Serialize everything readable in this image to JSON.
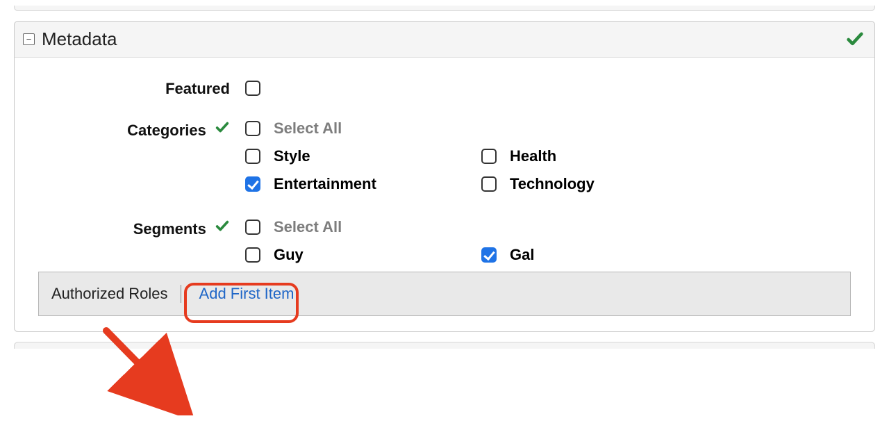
{
  "panel": {
    "title": "Metadata",
    "collapse_glyph": "−"
  },
  "featured": {
    "label": "Featured",
    "checked": false
  },
  "categories": {
    "label": "Categories",
    "section_valid": true,
    "select_all_label": "Select All",
    "select_all_checked": false,
    "options": [
      {
        "label": "Style",
        "checked": false
      },
      {
        "label": "Health",
        "checked": false
      },
      {
        "label": "Entertainment",
        "checked": true
      },
      {
        "label": "Technology",
        "checked": false
      }
    ]
  },
  "segments": {
    "label": "Segments",
    "section_valid": true,
    "select_all_label": "Select All",
    "select_all_checked": false,
    "options": [
      {
        "label": "Guy",
        "checked": false
      },
      {
        "label": "Gal",
        "checked": true
      }
    ]
  },
  "authorized_roles": {
    "title": "Authorized Roles",
    "add_link": "Add First Item"
  }
}
